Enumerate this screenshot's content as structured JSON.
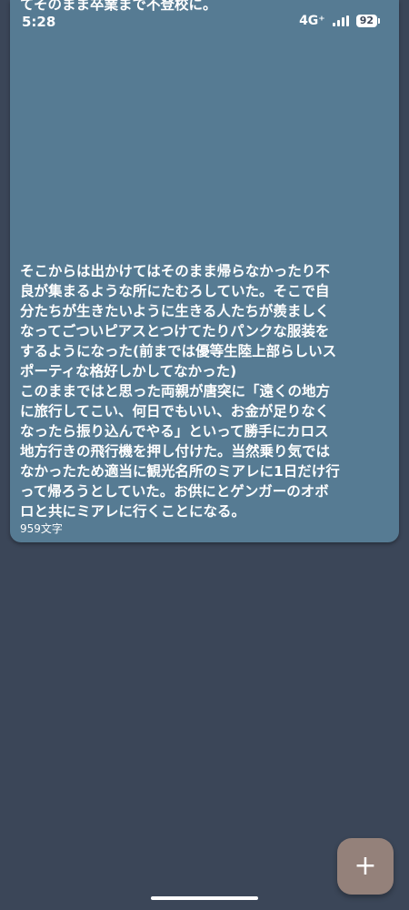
{
  "status_bar": {
    "time": "5:28",
    "network": "4G⁺",
    "battery": "92"
  },
  "note": {
    "top_text": "てそのまま卒業まで不登校に。",
    "paragraphs": [
      "そこからは出かけてはそのまま帰らなかったり不良が集まるような所にたむろしていた。そこで自分たちが生きたいように生きる人たちが羨ましくなってごついピアスとつけてたりパンクな服装をするようになった(前までは優等生陸上部らしいスポーティな格好しかしてなかった)",
      "このままではと思った両親が唐突に「遠くの地方に旅行してこい、何日でもいい、お金が足りなくなったら振り込んでやる」といって勝手にカロス地方行きの飛行機を押し付けた。当然乗り気ではなかったため適当に観光名所のミアレに1日だけ行って帰ろうとしていた。お供にとゲンガーのオボロと共にミアレに行くことになる。"
    ],
    "char_count": "959文字"
  },
  "fab": {
    "label": "+"
  },
  "colors": {
    "background": "#3b4658",
    "card": "#567b93",
    "fab": "#94817a"
  }
}
